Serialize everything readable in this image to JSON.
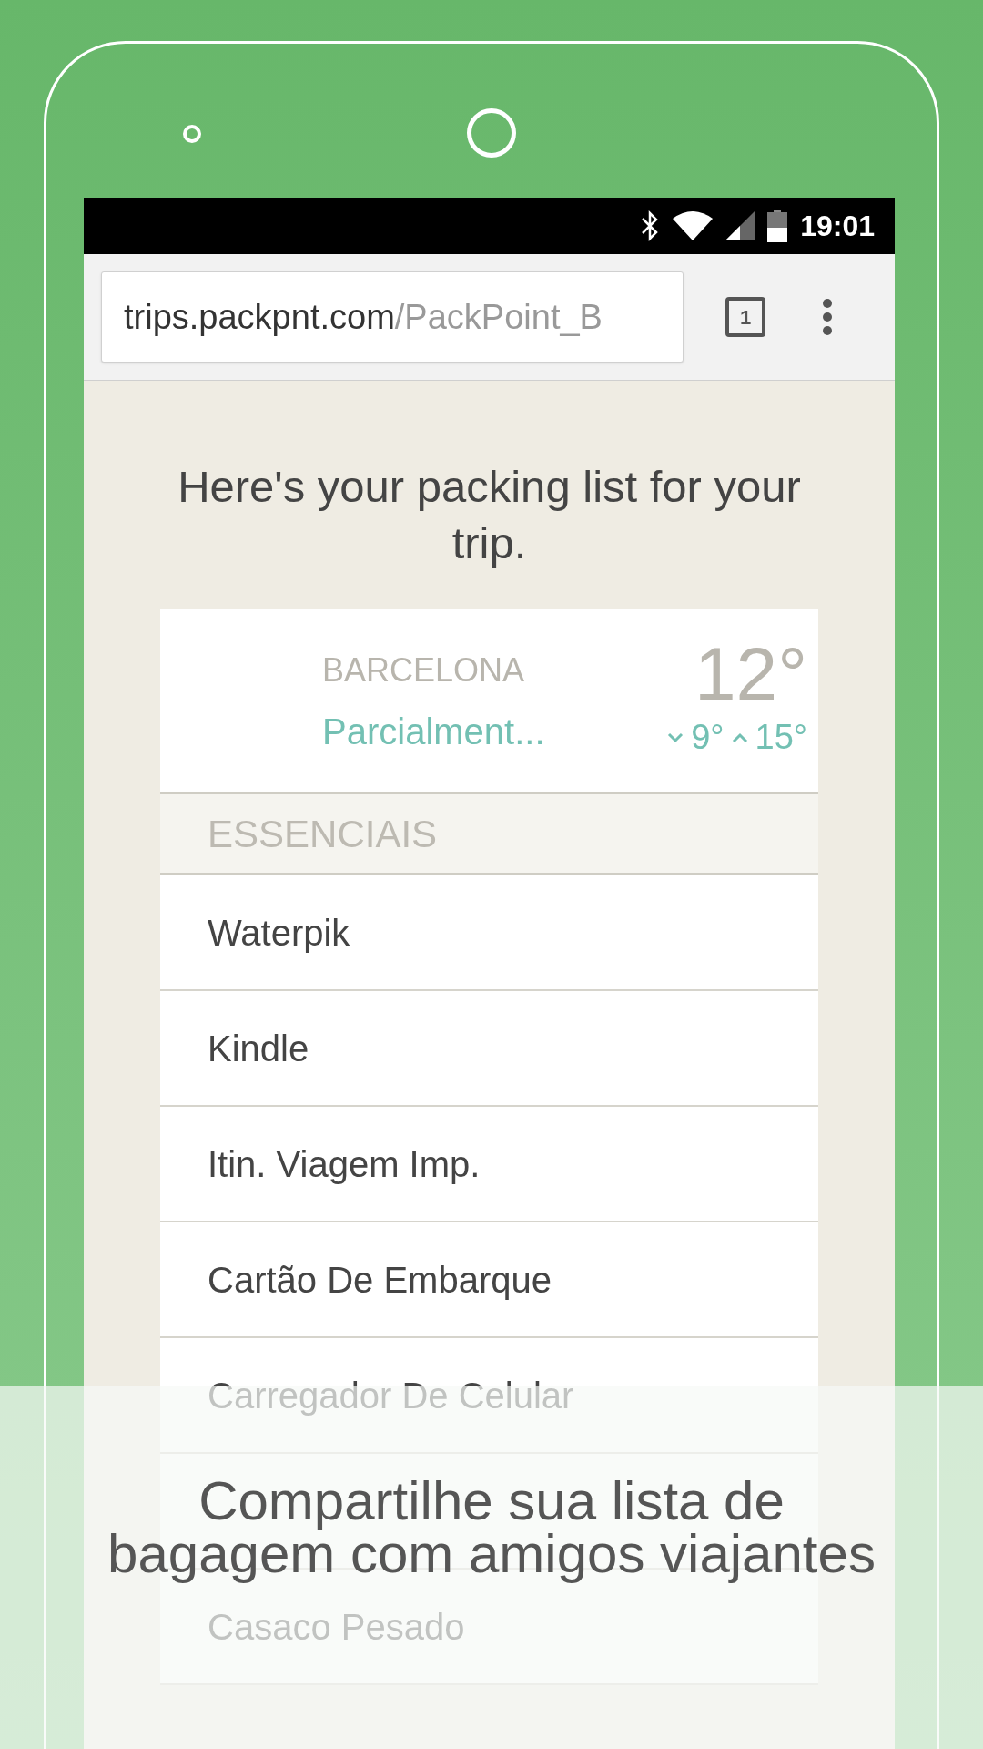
{
  "status_bar": {
    "time": "19:01"
  },
  "browser": {
    "url_host": "trips.packpnt.com",
    "url_path": "/PackPoint_B",
    "tab_count": "1"
  },
  "heading": "Here's your packing list for your trip.",
  "weather": {
    "city": "BARCELONA",
    "condition": "Parcialment...",
    "temperature": "12°",
    "low": "9°",
    "high": "15°"
  },
  "category": "ESSENCIAIS",
  "items": [
    "Waterpik",
    "Kindle",
    "Itin. Viagem Imp.",
    "Cartão De Embarque",
    "Carregador De Celular",
    "Casaco Pesado"
  ],
  "caption": "Compartilhe sua lista de bagagem com amigos viajantes"
}
